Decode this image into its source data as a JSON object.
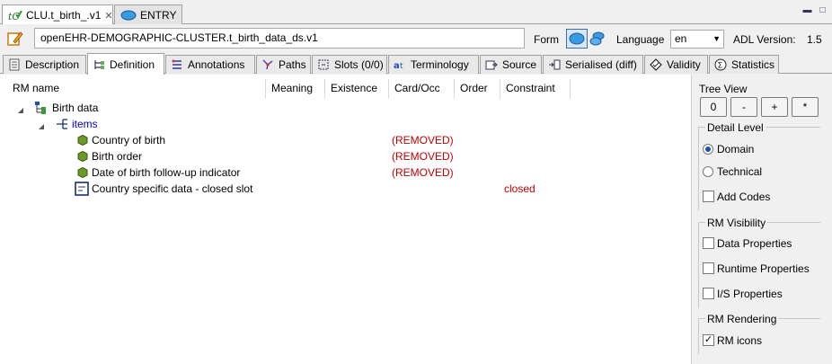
{
  "editor_tabs": [
    {
      "label": "CLU.t_birth_.v1",
      "active": true,
      "closable": true
    },
    {
      "label": "ENTRY",
      "active": false
    }
  ],
  "header": {
    "archetype_id": "openEHR-DEMOGRAPHIC-CLUSTER.t_birth_data_ds.v1",
    "form_label": "Form",
    "language_label": "Language",
    "language_value": "en",
    "adl_version_label": "ADL Version:",
    "adl_version_value": "1.5"
  },
  "view_tabs": [
    {
      "label": "Description",
      "icon": "description-icon"
    },
    {
      "label": "Definition",
      "icon": "definition-icon",
      "active": true
    },
    {
      "label": "Annotations",
      "icon": "annotations-icon"
    },
    {
      "label": "Paths",
      "icon": "paths-icon"
    },
    {
      "label": "Slots (0/0)",
      "icon": "slots-icon"
    },
    {
      "label": "Terminology",
      "icon": "terminology-icon"
    },
    {
      "label": "Source",
      "icon": "source-icon"
    },
    {
      "label": "Serialised (diff)",
      "icon": "serialised-icon"
    },
    {
      "label": "Validity",
      "icon": "validity-icon"
    },
    {
      "label": "Statistics",
      "icon": "statistics-icon"
    }
  ],
  "columns": [
    "RM name",
    "Meaning",
    "Existence",
    "Card/Occ",
    "Order",
    "Constraint"
  ],
  "tree": {
    "root": "Birth data",
    "items_label": "items",
    "rows": [
      {
        "name": "Country of birth",
        "card": "(REMOVED)"
      },
      {
        "name": "Birth order",
        "card": "(REMOVED)"
      },
      {
        "name": "Date of birth follow-up indicator",
        "card": "(REMOVED)"
      },
      {
        "name": "Country specific data - closed slot",
        "constraint": "closed"
      }
    ]
  },
  "side": {
    "tree_view_label": "Tree View",
    "tree_view_buttons": [
      "0",
      "-",
      "+",
      "*"
    ],
    "detail_level_label": "Detail Level",
    "domain_label": "Domain",
    "technical_label": "Technical",
    "add_codes_label": "Add Codes",
    "rm_visibility_label": "RM Visibility",
    "data_properties_label": "Data Properties",
    "runtime_properties_label": "Runtime Properties",
    "is_properties_label": "I/S Properties",
    "rm_rendering_label": "RM Rendering",
    "rm_icons_label": "RM icons"
  }
}
